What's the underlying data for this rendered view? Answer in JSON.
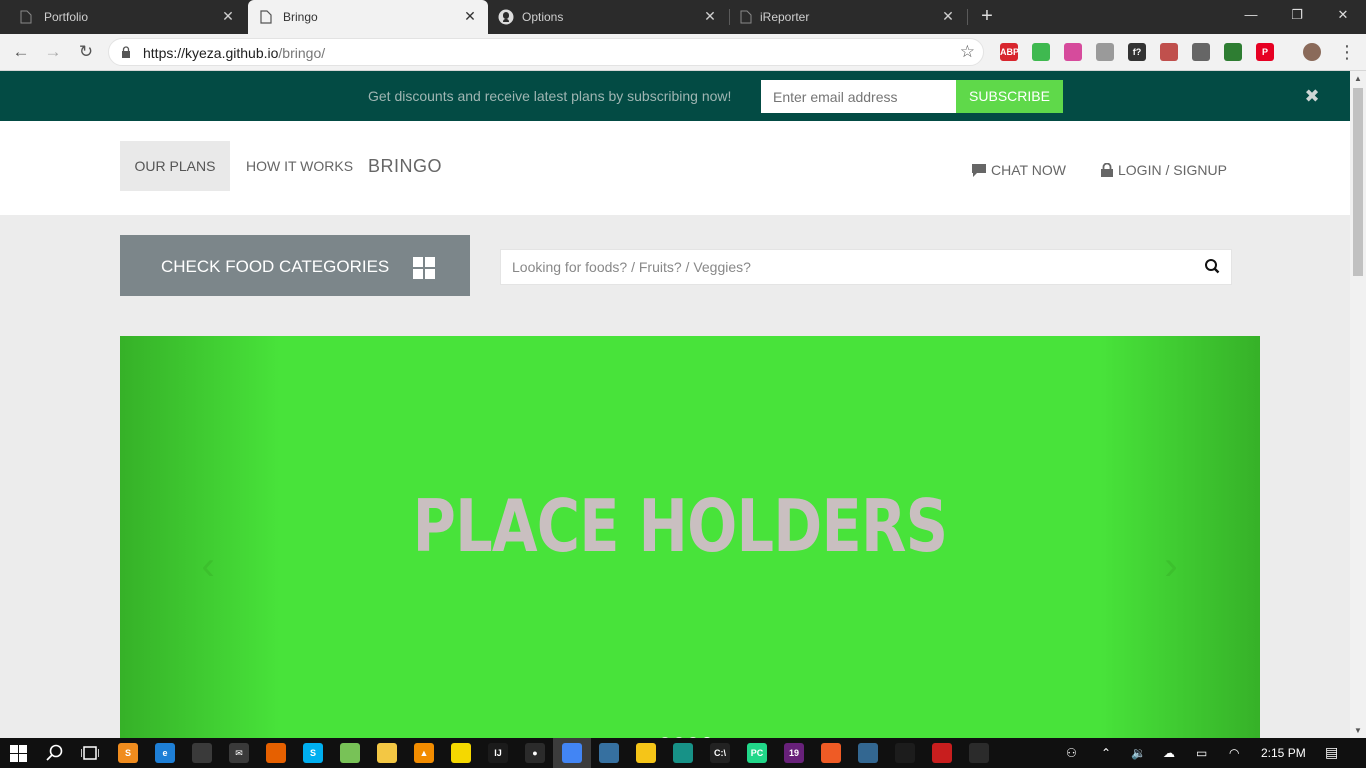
{
  "browser": {
    "tabs": [
      {
        "title": "Portfolio",
        "active": false
      },
      {
        "title": "Bringo",
        "active": true
      },
      {
        "title": "Options",
        "active": false
      },
      {
        "title": "iReporter",
        "active": false
      }
    ],
    "new_tab": "+",
    "url_host": "https://kyeza.github.io",
    "url_path": "/bringo/",
    "window_controls": {
      "minimize": "—",
      "maximize": "❐",
      "close": "✕"
    },
    "extensions": [
      {
        "name": "adblock-plus-icon",
        "label": "ABP",
        "color": "#d8262e"
      },
      {
        "name": "shield-extension-icon",
        "label": "",
        "color": "#3fb950"
      },
      {
        "name": "color-picker-icon",
        "label": "",
        "color": "#d64b9c"
      },
      {
        "name": "grid-extension-icon",
        "label": "",
        "color": "#9a9a9a"
      },
      {
        "name": "font-finder-icon",
        "label": "f?",
        "color": "#333333"
      },
      {
        "name": "pdf-extension-icon",
        "label": "",
        "color": "#c0504d"
      },
      {
        "name": "devtools-extension-icon",
        "label": "",
        "color": "#666666"
      },
      {
        "name": "globe-extension-icon",
        "label": "",
        "color": "#2e7d32"
      },
      {
        "name": "pinterest-icon",
        "label": "P",
        "color": "#e60023"
      }
    ]
  },
  "subscribe_bar": {
    "message": "Get discounts and receive latest plans by subscribing now!",
    "email_placeholder": "Enter email address",
    "button": "SUBSCRIBE",
    "close": "✖"
  },
  "nav": {
    "our_plans": "OUR PLANS",
    "how_it_works": "HOW IT WORKS",
    "brand": "BRINGO",
    "chat": "CHAT NOW",
    "login": "LOGIN / SIGNUP"
  },
  "categories": {
    "label": "CHECK FOOD CATEGORIES"
  },
  "search": {
    "placeholder": "Looking for foods? / Fruits? / Veggies?"
  },
  "hero": {
    "text": "PLACE HOLDERS",
    "prev": "‹",
    "next": "›",
    "slide_count": 4,
    "active_slide": 4
  },
  "taskbar": {
    "time": "2:15 PM",
    "apps": [
      {
        "name": "sublime-text-icon",
        "color": "#f08c1e",
        "label": "S"
      },
      {
        "name": "edge-icon",
        "color": "#1e7fd6",
        "label": "e"
      },
      {
        "name": "store-icon",
        "color": "#3a3a3a",
        "label": ""
      },
      {
        "name": "mail-icon",
        "color": "#3a3a3a",
        "label": "✉"
      },
      {
        "name": "firefox-icon",
        "color": "#e66000",
        "label": ""
      },
      {
        "name": "skype-icon",
        "color": "#00aff0",
        "label": "S"
      },
      {
        "name": "android-studio-icon",
        "color": "#78c257",
        "label": ""
      },
      {
        "name": "file-explorer-icon",
        "color": "#f3c744",
        "label": ""
      },
      {
        "name": "vlc-icon",
        "color": "#f28c00",
        "label": "▲"
      },
      {
        "name": "sticky-notes-icon",
        "color": "#f5d800",
        "label": ""
      },
      {
        "name": "intellij-icon",
        "color": "#1b1b1b",
        "label": "IJ"
      },
      {
        "name": "github-desktop-icon",
        "color": "#2b2b2b",
        "label": "●"
      },
      {
        "name": "chrome-icon",
        "color": "#4285f4",
        "label": ""
      },
      {
        "name": "python-idle-icon",
        "color": "#3670a0",
        "label": ""
      },
      {
        "name": "emoji-app-icon",
        "color": "#f5c518",
        "label": ""
      },
      {
        "name": "gitkraken-icon",
        "color": "#179287",
        "label": ""
      },
      {
        "name": "command-prompt-icon",
        "color": "#222222",
        "label": "C:\\"
      },
      {
        "name": "pycharm-icon",
        "color": "#21d789",
        "label": "PC"
      },
      {
        "name": "visual-studio-icon",
        "color": "#68217a",
        "label": "19"
      },
      {
        "name": "postman-icon",
        "color": "#ef5b25",
        "label": ""
      },
      {
        "name": "postgres-icon",
        "color": "#336791",
        "label": ""
      },
      {
        "name": "terminal-icon",
        "color": "#1c1c1c",
        "label": ""
      },
      {
        "name": "laravel-icon",
        "color": "#c81e1e",
        "label": ""
      },
      {
        "name": "git-icon",
        "color": "#2b2b2b",
        "label": ""
      }
    ]
  }
}
